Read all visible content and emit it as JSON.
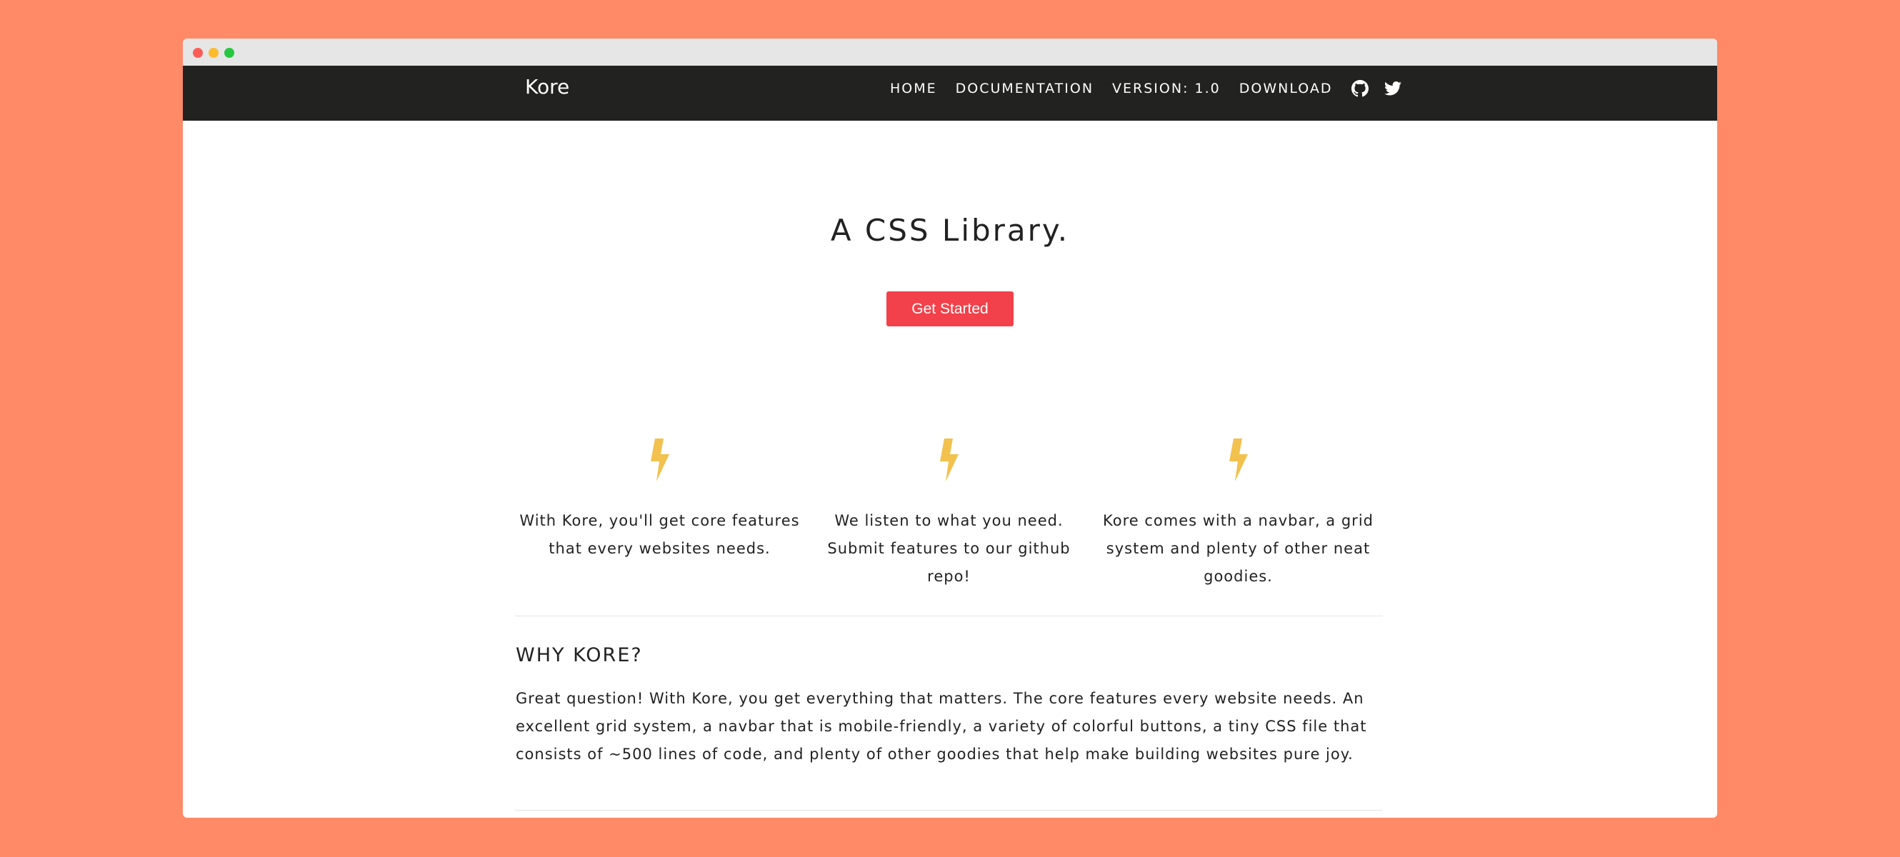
{
  "window": {
    "title_buttons": [
      "close",
      "minimize",
      "maximize"
    ]
  },
  "navbar": {
    "brand": "Kore",
    "links": [
      {
        "label": "HOME"
      },
      {
        "label": "DOCUMENTATION"
      },
      {
        "label": "VERSION: 1.0"
      },
      {
        "label": "DOWNLOAD"
      }
    ],
    "icons": [
      "github-icon",
      "twitter-icon"
    ]
  },
  "hero": {
    "title": "A CSS Library.",
    "cta_label": "Get Started"
  },
  "features": [
    {
      "icon": "lightning-bolt-icon",
      "text": "With Kore, you'll get core features that every websites needs."
    },
    {
      "icon": "lightning-bolt-icon",
      "text": "We listen to what you need. Submit features to our github repo!"
    },
    {
      "icon": "lightning-bolt-icon",
      "text": "Kore comes with a navbar, a grid system and plenty of other neat goodies."
    }
  ],
  "why": {
    "title": "WHY KORE?",
    "text": "Great question! With Kore, you get everything that matters. The core features every website needs. An excellent grid system, a navbar that is mobile-friendly, a variety of colorful buttons, a tiny CSS file that consists of ~500 lines of code, and plenty of other goodies that help make building websites pure joy."
  },
  "colors": {
    "background": "#FF8A68",
    "navbar": "#222220",
    "accent": "#F2414A",
    "bolt": "#F2C14E"
  }
}
